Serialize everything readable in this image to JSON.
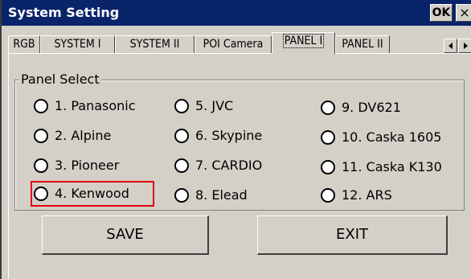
{
  "window": {
    "title": "System Setting",
    "ok_label": "OK",
    "close_label": "×"
  },
  "tabs": [
    {
      "label": "RGB"
    },
    {
      "label": "SYSTEM I"
    },
    {
      "label": "SYSTEM II"
    },
    {
      "label": "POI Camera"
    },
    {
      "label": "PANEL I",
      "active": true
    },
    {
      "label": "PANEL II"
    }
  ],
  "panel_select": {
    "label": "Panel Select",
    "selected": "4. Kenwood",
    "options": [
      "1. Panasonic",
      "2. Alpine",
      "3. Pioneer",
      "4. Kenwood",
      "5. JVC",
      "6. Skypine",
      "7. CARDIO",
      "8. Elead",
      "9. DV621",
      "10. Caska 1605",
      "11. Caska K130",
      "12. ARS"
    ]
  },
  "buttons": {
    "save": "SAVE",
    "exit": "EXIT"
  },
  "colors": {
    "titlebar": "#0a246a",
    "face": "#d4d0c8",
    "highlight_box": "#e3000f"
  }
}
